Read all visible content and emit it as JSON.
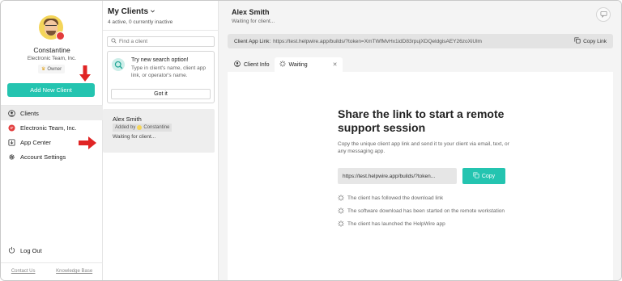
{
  "sidebar": {
    "user_name": "Constantine",
    "org_name": "Electronic Team, Inc.",
    "role": "Owner",
    "add_button": "Add New Client",
    "nav": [
      {
        "label": "Clients",
        "icon": "person-circle-icon"
      },
      {
        "label": "Electronic Team, Inc.",
        "icon": "org-logo-icon"
      },
      {
        "label": "App Center",
        "icon": "download-box-icon"
      },
      {
        "label": "Account Settings",
        "icon": "gear-icon"
      }
    ],
    "logout": "Log Out",
    "footer": {
      "contact": "Contact Us",
      "kb": "Knowledge Base"
    }
  },
  "clients_panel": {
    "title": "My Clients",
    "subtitle": "4 active, 0 currently inactive",
    "search_placeholder": "Find a client",
    "tip": {
      "title": "Try new search option!",
      "text": "Type in client's name, client app link, or operator's name.",
      "button": "Got it"
    },
    "card": {
      "name": "Alex Smith",
      "added_by_label": "Added by",
      "added_by_name": "Constantine",
      "status": "Waiting for client..."
    }
  },
  "main": {
    "title": "Alex Smith",
    "subtitle": "Waiting for client...",
    "link_label": "Client App Link:",
    "link_url": "https://test.helpwire.app/builds/?token=XmTWfMvHx1idD83rpujXDQeldgisAEY26zoXiUlm",
    "copy_link": "Copy Link",
    "tabs": [
      {
        "label": "Client Info",
        "icon": "person-circle-icon"
      },
      {
        "label": "Waiting",
        "icon": "spinner-icon"
      }
    ],
    "share_title": "Share the link to start a remote support session",
    "share_desc": "Copy the unique client app link and send it to your client via email, text, or any messaging app.",
    "url_field": "https://test.helpwire.app/builds/?token...",
    "copy_button": "Copy",
    "steps": [
      "The client has followed the download link",
      "The software download has been started on the remote workstation",
      "The client has launched the HelpWire app"
    ]
  },
  "colors": {
    "accent": "#24c4b0",
    "annotation_arrow": "#e02424",
    "brand_red": "#e23c3c"
  }
}
